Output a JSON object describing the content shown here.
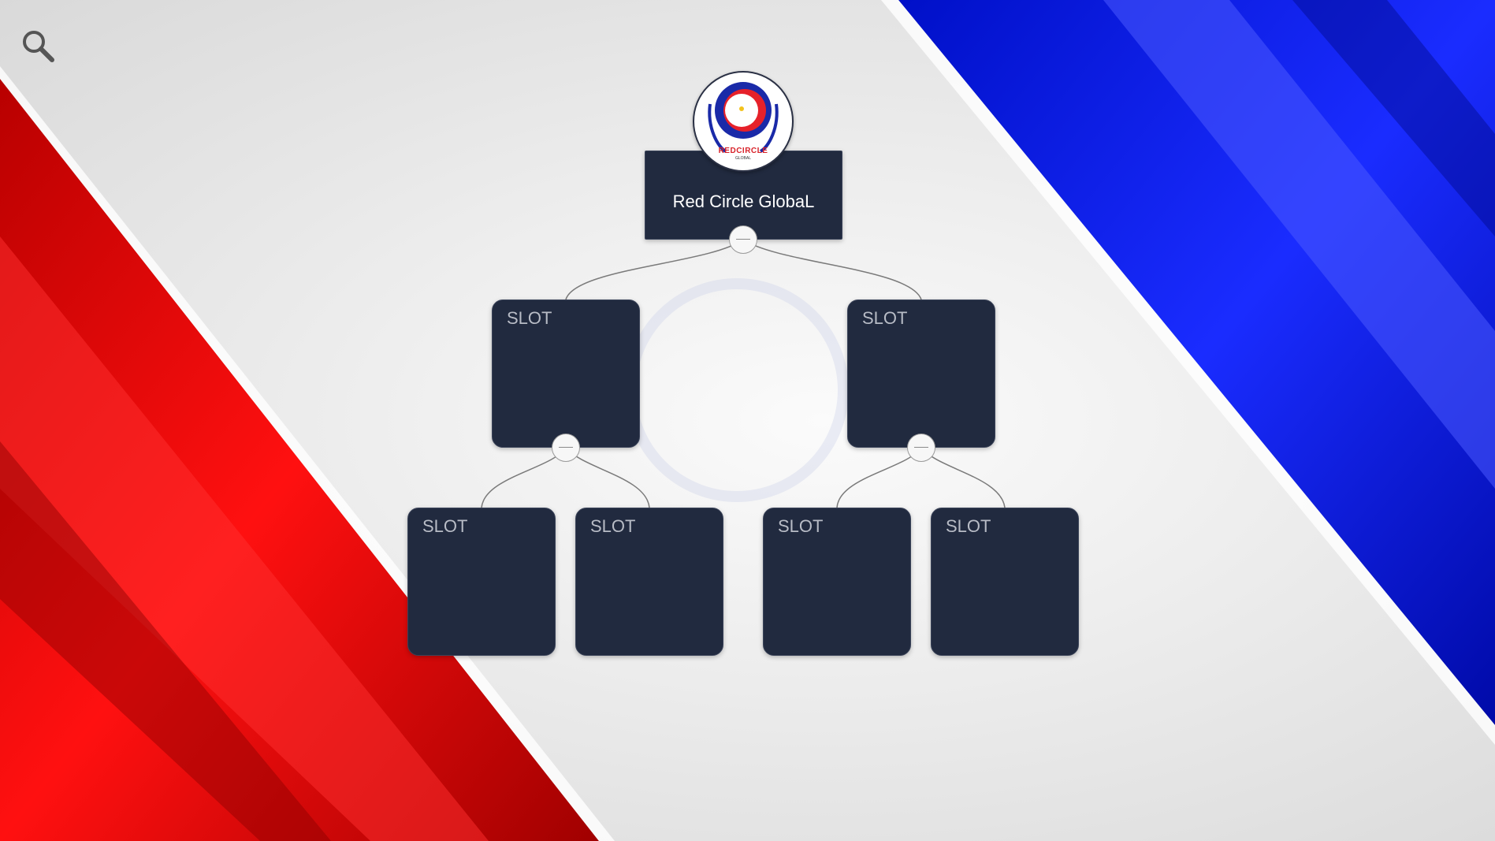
{
  "toolbar": {
    "search_icon": "search-icon"
  },
  "colors": {
    "red_accent": "#e00000",
    "blue_accent": "#0a14d8",
    "node_fill": "#212a3f",
    "background": "#ececec"
  },
  "org_chart": {
    "root": {
      "label": "Red Circle GlobaL",
      "logo_text": "REDCIRCLE",
      "logo_subtext": "GLOBAL"
    },
    "level1": [
      {
        "label": "SLOT"
      },
      {
        "label": "SLOT"
      }
    ],
    "level2": [
      {
        "label": "SLOT"
      },
      {
        "label": "SLOT"
      },
      {
        "label": "SLOT"
      },
      {
        "label": "SLOT"
      }
    ]
  }
}
